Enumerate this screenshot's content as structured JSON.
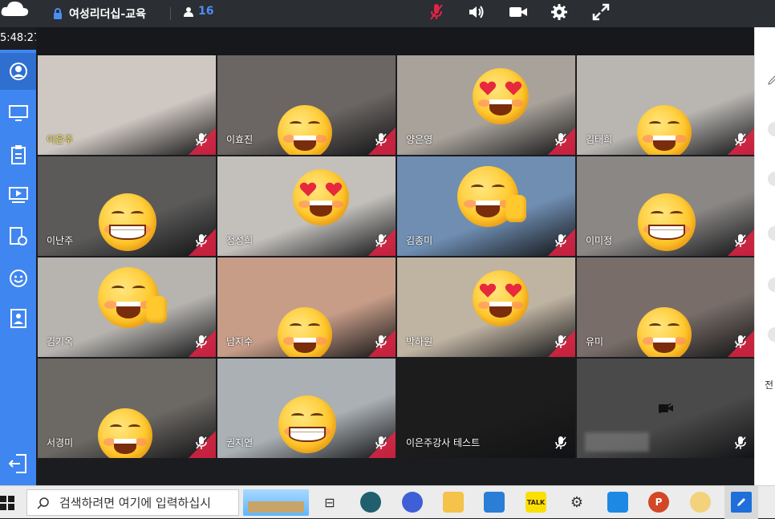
{
  "header": {
    "room_title": "여성리더십-교육",
    "participant_count": "16"
  },
  "timer": "5:48:27",
  "participants": [
    {
      "name": "이은주",
      "speaker": true,
      "bg": "#cfc7c1",
      "emoji": "none"
    },
    {
      "name": "이효진",
      "speaker": false,
      "bg": "#6b6663",
      "emoji": "smile"
    },
    {
      "name": "양은영",
      "speaker": false,
      "bg": "#a8a29a",
      "emoji": "heart"
    },
    {
      "name": "김태희",
      "speaker": false,
      "bg": "#b9b6b2",
      "emoji": "smile"
    },
    {
      "name": "이난주",
      "speaker": false,
      "bg": "#5b5a59",
      "emoji": "grin"
    },
    {
      "name": "정성희",
      "speaker": false,
      "bg": "#c3c0bc",
      "emoji": "heart"
    },
    {
      "name": "김종미",
      "speaker": false,
      "bg": "#6f8eb2",
      "emoji": "thumb"
    },
    {
      "name": "이미정",
      "speaker": false,
      "bg": "#8a8785",
      "emoji": "grin"
    },
    {
      "name": "김기옥",
      "speaker": false,
      "bg": "#b7b4b0",
      "emoji": "thumb"
    },
    {
      "name": "남지수",
      "speaker": false,
      "bg": "#c79d88",
      "emoji": "smile"
    },
    {
      "name": "박하원",
      "speaker": false,
      "bg": "#bfb3a2",
      "emoji": "heart"
    },
    {
      "name": "유미",
      "speaker": false,
      "bg": "#786d68",
      "emoji": "smile"
    },
    {
      "name": "서경미",
      "speaker": false,
      "bg": "#6c6864",
      "emoji": "smile"
    },
    {
      "name": "권지연",
      "speaker": false,
      "bg": "#aab0b4",
      "emoji": "grin"
    },
    {
      "name": "이은주강사 테스트",
      "speaker": false,
      "bg": "#1c1c1c",
      "emoji": "none"
    },
    {
      "name": "",
      "speaker": false,
      "bg": "#4a4a4a",
      "emoji": "none"
    }
  ],
  "right_panel": {
    "label": "전"
  },
  "taskbar": {
    "search_placeholder": "검색하려면 여기에 입력하십시"
  },
  "colors": {
    "sidebar": "#3f86f0",
    "accent_count": "#4c8df5",
    "speaker_name": "#f6e443",
    "mute_corner": "#e22344"
  }
}
